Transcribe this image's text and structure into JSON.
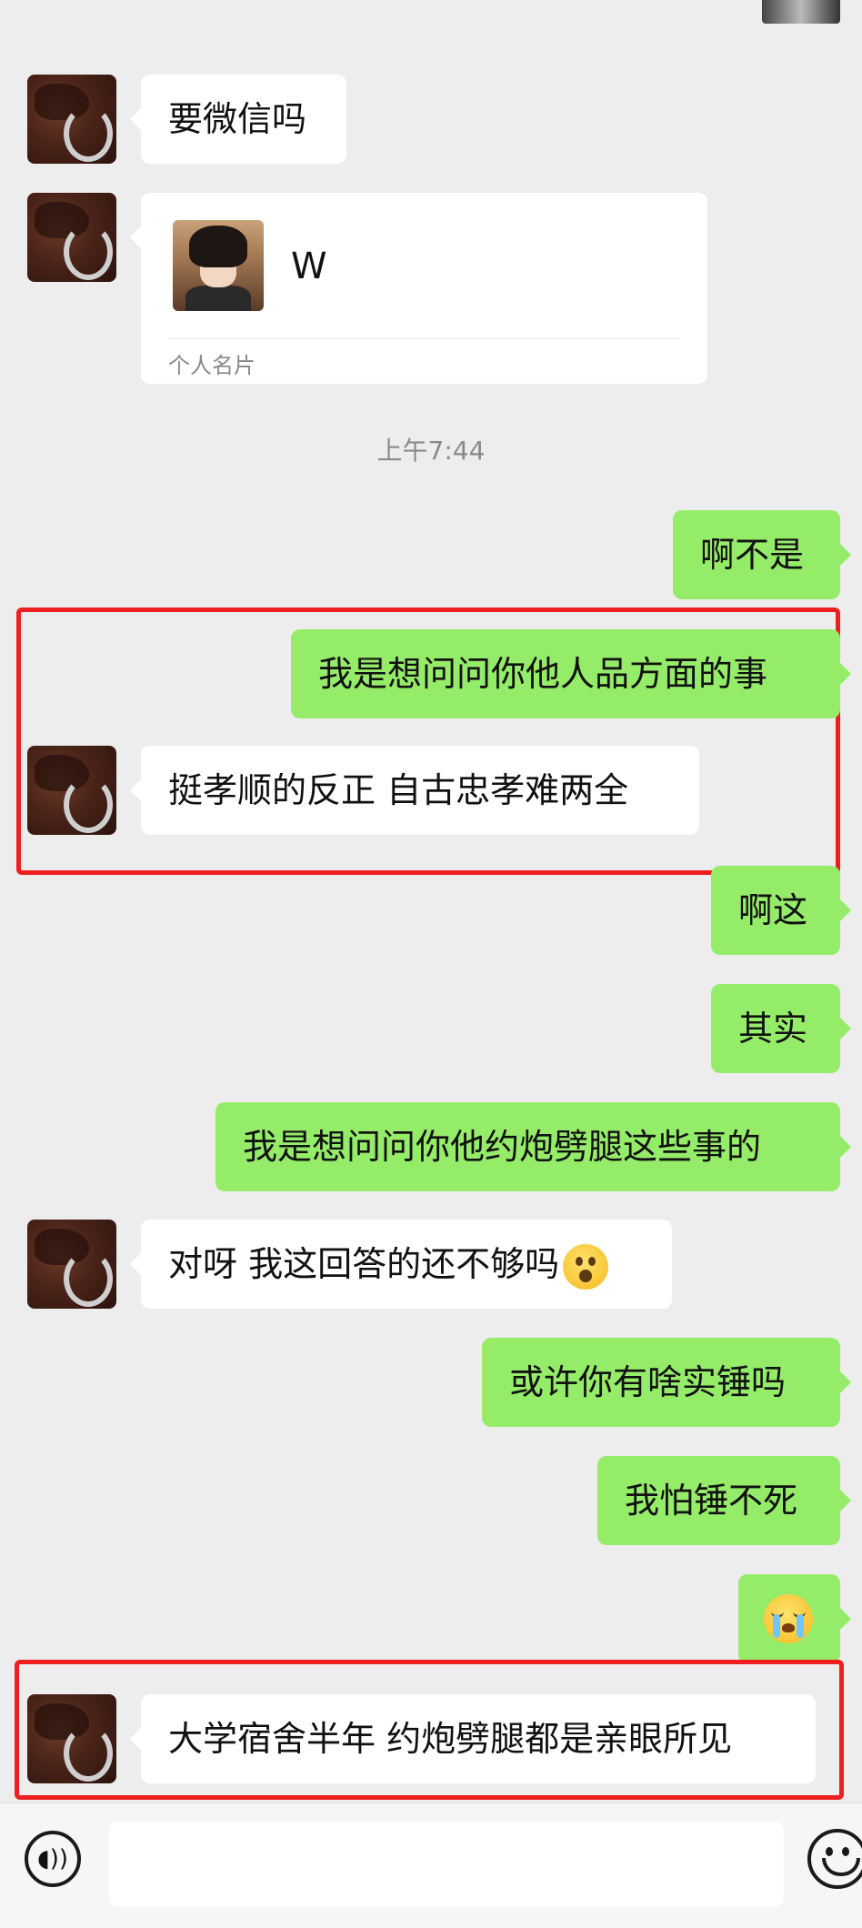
{
  "app": {
    "accent_color": "#95ec69",
    "incoming_color": "#ffffff",
    "background_color": "#ededed",
    "highlight_color": "#f01f1f"
  },
  "messages": {
    "m1": "要微信吗",
    "m3": "啊不是",
    "m4": "我是想问问你他人品方面的事",
    "m5": "挺孝顺的反正 自古忠孝难两全",
    "m6": "啊这",
    "m7": "其实",
    "m8": "我是想问问你他约炮劈腿这些事的",
    "m9": "对呀 我这回答的还不够吗",
    "m10": "或许你有啥实锤吗",
    "m11": "我怕锤不死",
    "m13": "大学宿舍半年 约炮劈腿都是亲眼所见"
  },
  "contact_card": {
    "name": "W",
    "type_label": "个人名片"
  },
  "timestamp": "上午7:44",
  "icons": {
    "voice": "voice-icon",
    "emoji": "emoji-icon",
    "surprised": "surprised-emoji",
    "crying": "crying-emoji"
  }
}
